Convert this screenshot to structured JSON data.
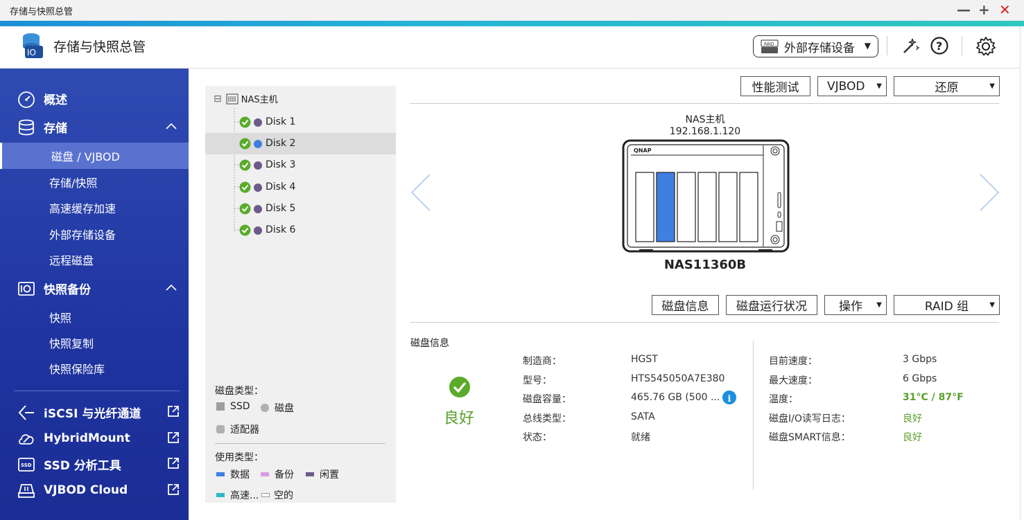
{
  "window": {
    "title": "存储与快照总管",
    "minimize": "—",
    "maximize": "+",
    "close": "✕"
  },
  "header": {
    "app_title": "存储与快照总管",
    "ext_device_label": "外部存储设备",
    "ext_device_badge": "RAID"
  },
  "sidebar": {
    "overview": "概述",
    "storage": "存储",
    "storage_items": [
      "磁盘 / VJBOD",
      "存储/快照",
      "高速缓存加速",
      "外部存储设备",
      "远程磁盘"
    ],
    "snapshot": "快照备份",
    "snapshot_items": [
      "快照",
      "快照复制",
      "快照保险库"
    ],
    "links": [
      "iSCSI 与光纤通道",
      "HybridMount",
      "SSD 分析工具",
      "VJBOD Cloud"
    ],
    "ssd_badge": "SSD"
  },
  "tree": {
    "root": "NAS主机",
    "collapse": "⊟",
    "disks": [
      {
        "label": "Disk 1",
        "color": "#6e5a8a"
      },
      {
        "label": "Disk 2",
        "color": "#3f7fe0"
      },
      {
        "label": "Disk 3",
        "color": "#6e5a8a"
      },
      {
        "label": "Disk 4",
        "color": "#6e5a8a"
      },
      {
        "label": "Disk 5",
        "color": "#6e5a8a"
      },
      {
        "label": "Disk 6",
        "color": "#6e5a8a"
      }
    ],
    "selected_index": 1,
    "disk_type_title": "磁盘类型：",
    "disk_types": {
      "ssd": "SSD",
      "hdd": "磁盘",
      "adapter": "适配器"
    },
    "usage_title": "使用类型：",
    "usage": {
      "data": "数据",
      "backup": "备份",
      "free": "闲置",
      "cache": "高速...",
      "empty": "空的"
    },
    "colors": {
      "data": "#3f7fe0",
      "backup": "#d79be6",
      "free": "#6e5a8a",
      "cache": "#2ab8c8"
    }
  },
  "toolbar": {
    "perf_test": "性能测试",
    "vjbod": "VJBOD",
    "restore": "还原"
  },
  "nas": {
    "name": "NAS主机",
    "ip": "192.168.1.120",
    "model": "NAS11360B",
    "brand": "QNAP",
    "highlighted_slot": 2
  },
  "actions": {
    "disk_info": "磁盘信息",
    "disk_health": "磁盘运行状况",
    "operation": "操作",
    "raid_group": "RAID 组"
  },
  "info": {
    "title": "磁盘信息",
    "status_label": "良好",
    "left": [
      {
        "k": "制造商：",
        "v": "HGST"
      },
      {
        "k": "型号：",
        "v": "HTS545050A7E380"
      },
      {
        "k": "磁盘容量：",
        "v": "465.76 GB (500 ..."
      },
      {
        "k": "总线类型：",
        "v": "SATA"
      },
      {
        "k": "状态：",
        "v": "就绪"
      }
    ],
    "right": [
      {
        "k": "目前速度：",
        "v": "3 Gbps"
      },
      {
        "k": "最大速度：",
        "v": "6 Gbps"
      },
      {
        "k": "温度：",
        "v": "31°C / 87°F"
      },
      {
        "k": "磁盘I/O读写日志：",
        "v": "良好"
      },
      {
        "k": "磁盘SMART信息：",
        "v": "良好"
      }
    ]
  }
}
